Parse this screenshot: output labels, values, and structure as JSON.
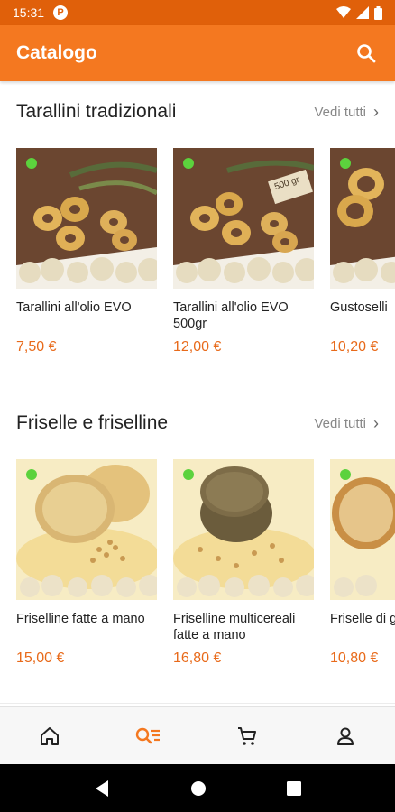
{
  "status_bar": {
    "time": "15:31",
    "app_badge": "P"
  },
  "app_bar": {
    "title": "Catalogo",
    "search_icon": "search-icon"
  },
  "sections": [
    {
      "title": "Tarallini tradizionali",
      "see_all": "Vedi tutti",
      "products": [
        {
          "name": "Tarallini all'olio EVO",
          "price": "7,50 €",
          "badge": ""
        },
        {
          "name": "Tarallini all'olio EVO 500gr",
          "price": "12,00 €",
          "badge": "500 gr"
        },
        {
          "name": "Gustoselli",
          "price": "10,20 €",
          "badge": ""
        }
      ]
    },
    {
      "title": "Friselle e friselline",
      "see_all": "Vedi tutti",
      "products": [
        {
          "name": "Friselline fatte a mano",
          "price": "15,00 €"
        },
        {
          "name": "Friselline multicereali fatte a mano",
          "price": "16,80 €"
        },
        {
          "name": "Friselle di grano",
          "price": "10,80 €"
        }
      ]
    }
  ],
  "bottom_nav": [
    {
      "icon": "home-icon",
      "active": false
    },
    {
      "icon": "catalog-search-icon",
      "active": true
    },
    {
      "icon": "cart-icon",
      "active": false
    },
    {
      "icon": "profile-icon",
      "active": false
    }
  ],
  "colors": {
    "status_bar": "#e0600a",
    "app_bar": "#f47820",
    "price": "#e86a1a",
    "available_dot": "#5cd23d",
    "active_nav": "#f47820"
  }
}
